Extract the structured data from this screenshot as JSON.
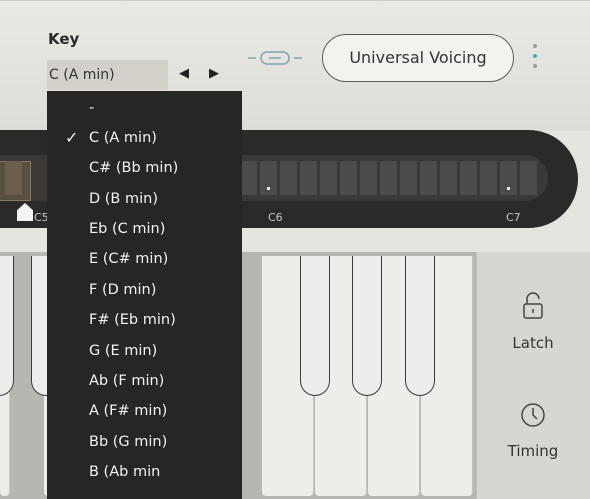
{
  "key_section": {
    "label": "Key",
    "selected": "C (A min)"
  },
  "nav": {
    "prev": "◀",
    "next": "▶"
  },
  "link_icon": "link-icon",
  "voicing_button": {
    "label": "Universal Voicing"
  },
  "range_strip": {
    "labels": [
      "C5",
      "C6",
      "C7"
    ]
  },
  "side_panel": {
    "latch_label": "Latch",
    "timing_label": "Timing"
  },
  "dropdown": {
    "checkmark": "✓",
    "items": [
      "-",
      "C (A min)",
      "C# (Bb min)",
      "D (B min)",
      "Eb (C min)",
      "E (C# min)",
      "F (D min)",
      "F# (Eb min)",
      "G (E min)",
      "Ab (F min)",
      "A (F# min)",
      "Bb (G min)",
      "B (Ab min"
    ],
    "selected_index": 1
  },
  "colors": {
    "accent": "#4ca8c2",
    "dropdown_bg": "#262626",
    "strip_bg": "#2b2a29"
  }
}
